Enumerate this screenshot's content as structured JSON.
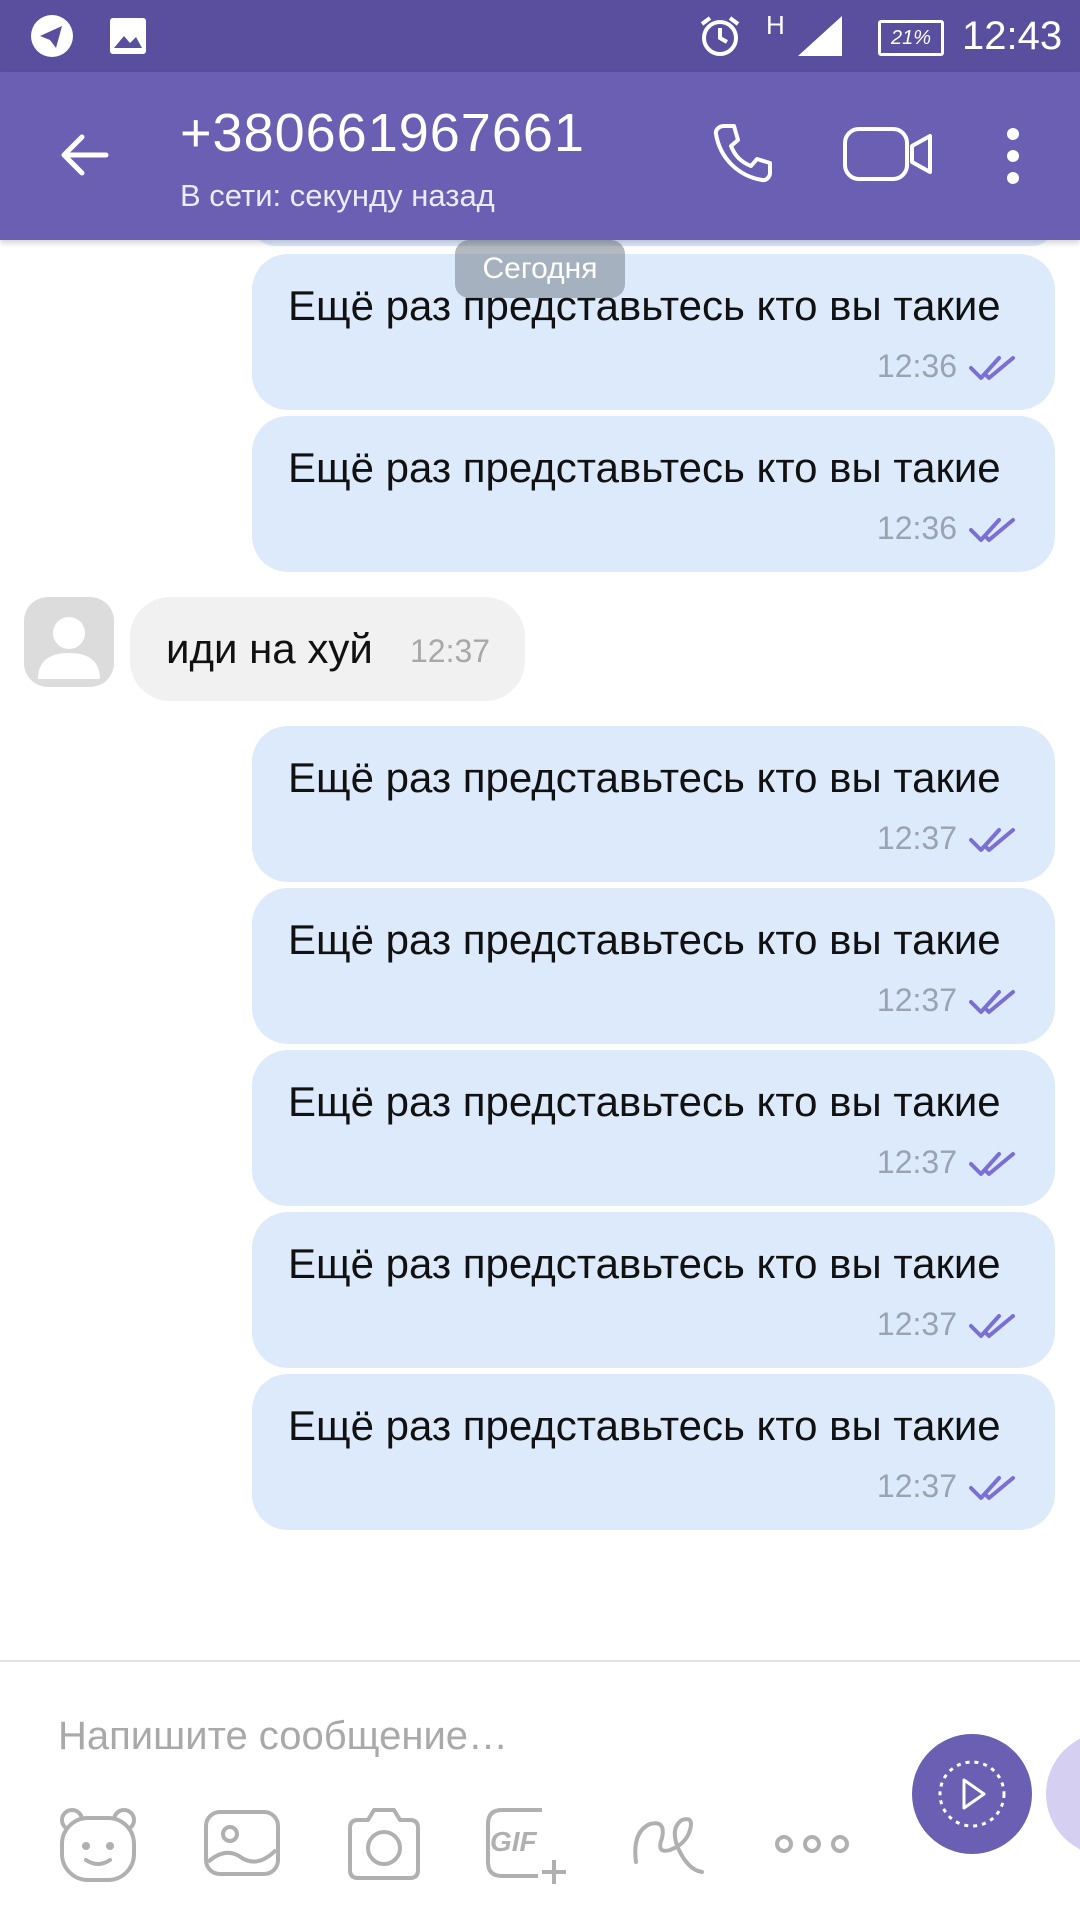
{
  "status_bar": {
    "time": "12:43",
    "battery": "21%",
    "network": "H",
    "icons": [
      "telegram-icon",
      "gallery-icon",
      "alarm-icon",
      "signal-icon",
      "battery-icon"
    ]
  },
  "header": {
    "title": "+380661967661",
    "subtitle": "В сети: секунду назад",
    "actions": [
      "back-icon",
      "phone-icon",
      "video-icon",
      "more-icon"
    ]
  },
  "chat": {
    "date_divider": "Сегодня",
    "outgoing_top": [
      {
        "text": "Ещё раз представьтесь кто вы такие",
        "time": "12:36"
      },
      {
        "text": "Ещё раз представьтесь кто вы такие",
        "time": "12:36"
      }
    ],
    "incoming": {
      "text": "иди на хуй",
      "time": "12:37"
    },
    "outgoing_bottom": [
      {
        "text": "Ещё раз представьтесь кто вы такие",
        "time": "12:37"
      },
      {
        "text": "Ещё раз представьтесь кто вы такие",
        "time": "12:37"
      },
      {
        "text": "Ещё раз представьтесь кто вы такие",
        "time": "12:37"
      },
      {
        "text": "Ещё раз представьтесь кто вы такие",
        "time": "12:37"
      },
      {
        "text": "Ещё раз представьтесь кто вы такие",
        "time": "12:37"
      }
    ]
  },
  "composer": {
    "placeholder": "Напишите сообщение…",
    "gif_label": "GIF",
    "tools": [
      "sticker-icon",
      "gallery-icon",
      "camera-icon",
      "gif-icon",
      "doodle-icon",
      "more-options-icon",
      "voice-record-button"
    ]
  },
  "colors": {
    "status_bar": "#5a4f9f",
    "app_bar": "#6a5fb3",
    "bubble_out": "#dceafc",
    "bubble_in": "#f1f1f1",
    "tick": "#7b6fd6"
  }
}
